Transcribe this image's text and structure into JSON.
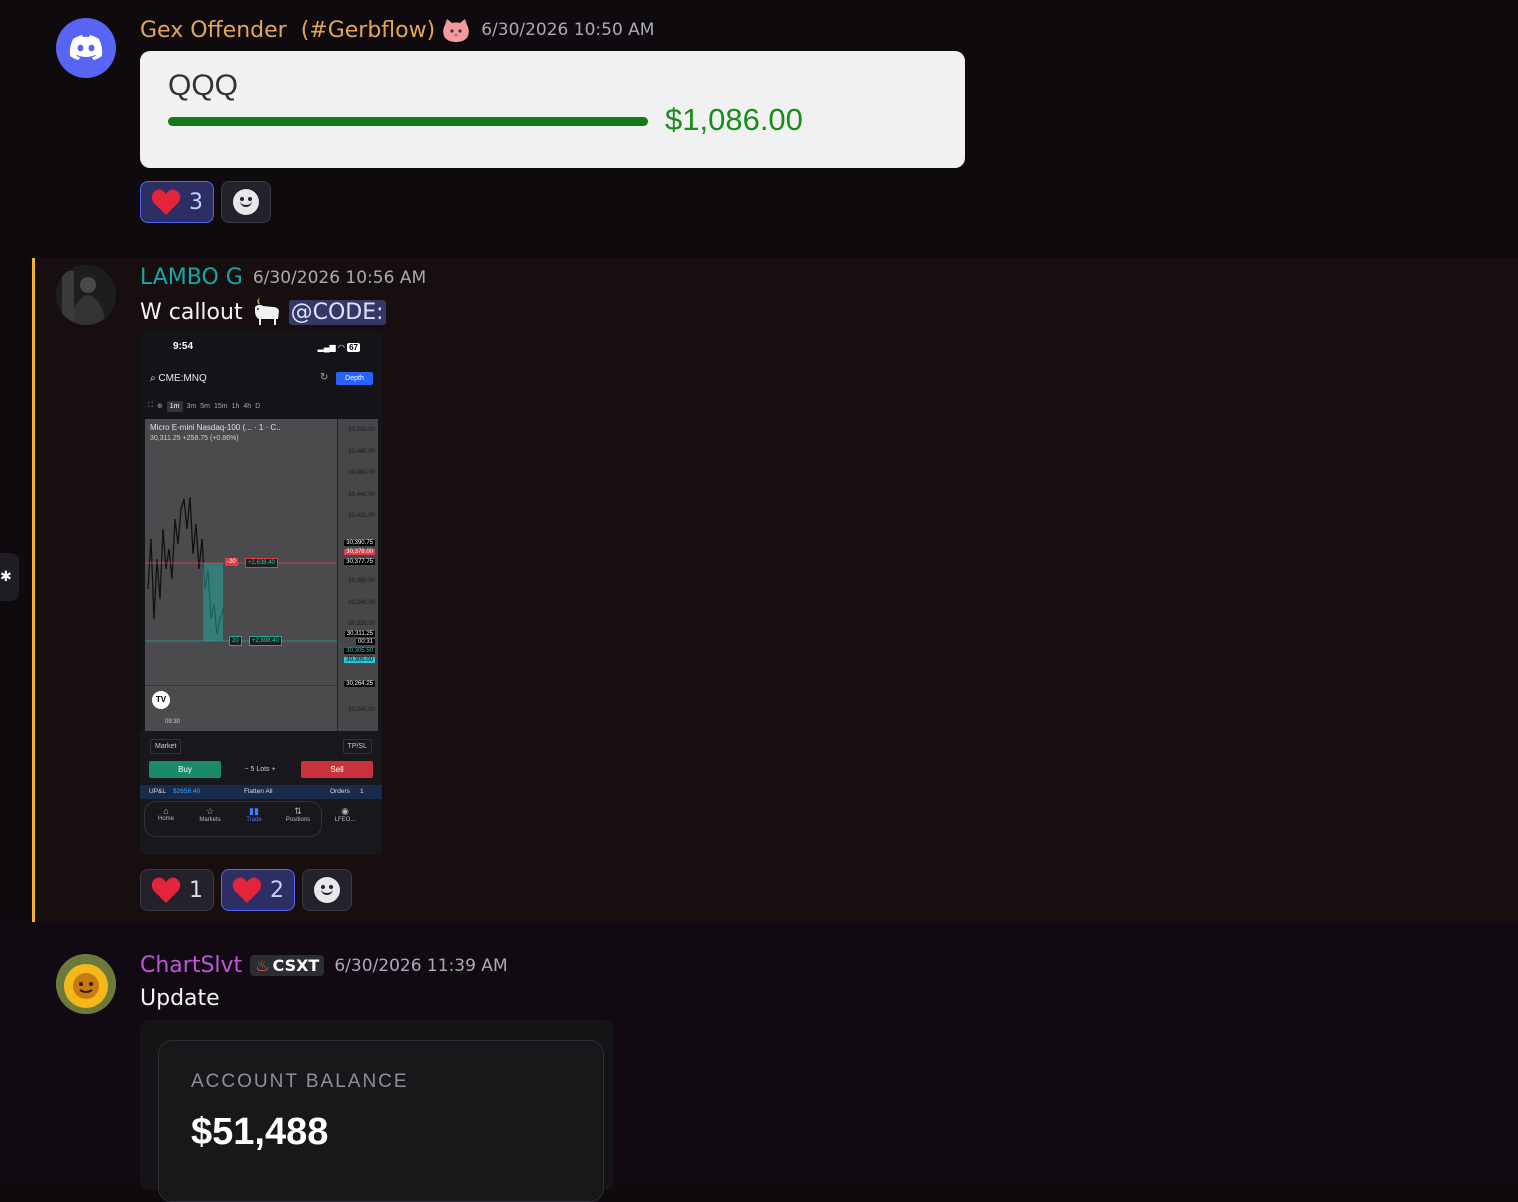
{
  "messages": [
    {
      "author": "Gex Offender  (#Gerbflow)",
      "author_color": "#e3a75a",
      "badge_icon": "pink-creature-emoji",
      "timestamp": "6/30/2026 10:50 AM",
      "card": {
        "ticker": "QQQ",
        "amount": "$1,086.00"
      },
      "reactions": [
        {
          "icon": "heart-icon",
          "count": "3",
          "me": true
        }
      ]
    },
    {
      "author": "LAMBO G",
      "author_color": "#1aa6a8",
      "timestamp": "6/30/2026 10:56 AM",
      "text": "W callout",
      "emoji": "goat-emoji",
      "mention": "@CODE:",
      "reactions": [
        {
          "icon": "heart-icon",
          "count": "1",
          "me": false
        },
        {
          "icon": "heart-icon",
          "count": "2",
          "me": true
        }
      ]
    },
    {
      "author": "ChartSlvt",
      "author_color": "#c057d8",
      "tag": "CSXT",
      "timestamp": "6/30/2026 11:39 AM",
      "text": "Update",
      "account": {
        "label": "ACCOUNT BALANCE",
        "value": "$51,488"
      }
    }
  ],
  "phone": {
    "time": "9:54",
    "battery": "67",
    "symbol": "CME:MNQ",
    "depth": "Depth",
    "timeframes": [
      "1m",
      "3m",
      "5m",
      "15m",
      "1h",
      "4h",
      "D"
    ],
    "title": "Micro E-mini Nasdaq-100 (... · 1 · C..",
    "quote": "30,311.25 +258.75 (+0.86%)",
    "price_axis": [
      "30,500.00",
      "30,480.00",
      "30,460.00",
      "30,440.00",
      "30,420.00",
      "30,390.75",
      "30,378.00",
      "30,377.75",
      "30,360.00",
      "30,340.00",
      "30,320.00",
      "30,311.25",
      "00:31",
      "30,305.50",
      "30,305.00",
      "30,264.25",
      "30,240.00"
    ],
    "order_short": {
      "qty": "-20",
      "pnl": "+2,638.40"
    },
    "order_long": {
      "qty": "20",
      "pnl": "+2,898.40"
    },
    "time_label": "09:30",
    "market": "Market",
    "tpsl": "TP/SL",
    "buy": "Buy",
    "sell": "Sell",
    "lots": "5",
    "lots_label": "Lots",
    "upl_label": "UP&L",
    "upl_value": "$2658.40",
    "flatten": "Flatten All",
    "orders": "Orders",
    "orders_count": "1",
    "tabs": [
      "Home",
      "Markets",
      "Trade",
      "Positions",
      "LFEO..."
    ]
  }
}
